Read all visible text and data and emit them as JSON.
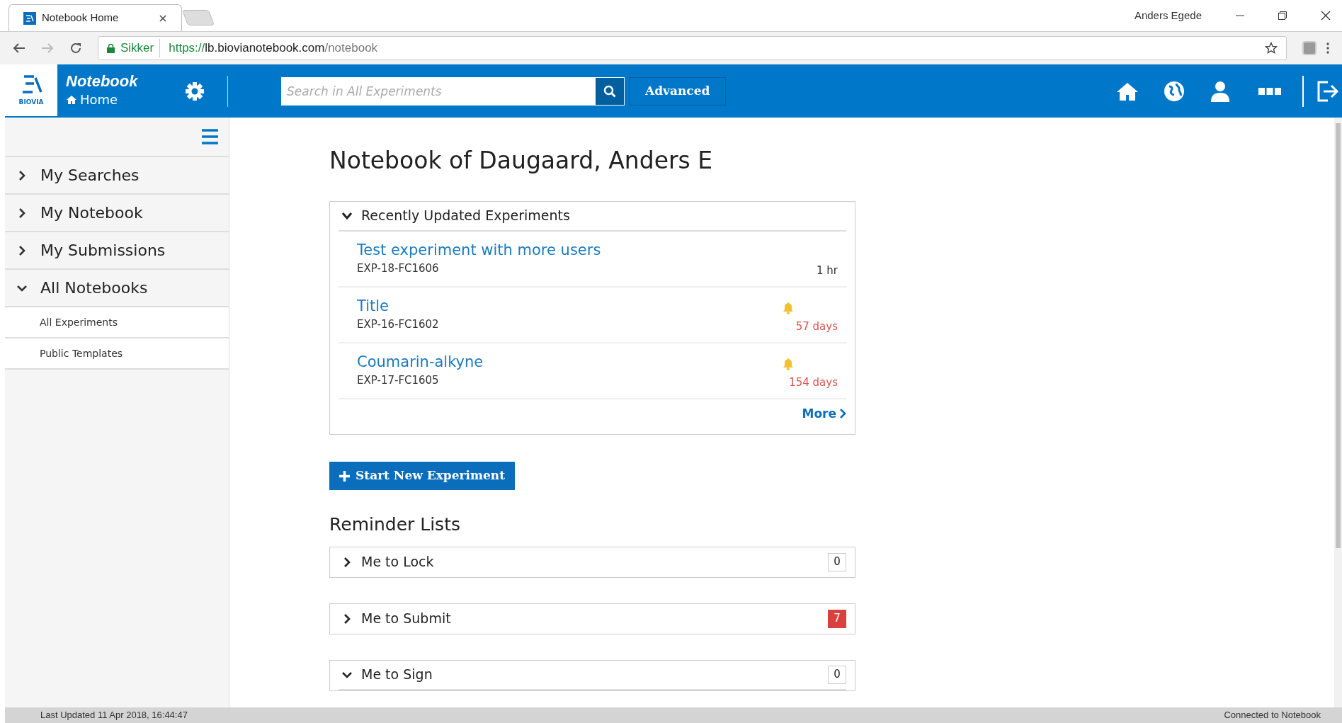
{
  "browser": {
    "tab_title": "Notebook Home",
    "user": "Anders Egede",
    "security_label": "Sikker",
    "url_scheme": "https://",
    "url_host": "lb.biovianotebook.com",
    "url_path": "/notebook"
  },
  "header": {
    "app_name": "Notebook",
    "logo_caption": "BIOVIA",
    "page": "Home",
    "search": {
      "placeholder": "Search in All Experiments"
    },
    "advanced_button": "Advanced"
  },
  "sidebar": {
    "items": [
      {
        "label": "My Searches",
        "expanded": false
      },
      {
        "label": "My Notebook",
        "expanded": false
      },
      {
        "label": "My Submissions",
        "expanded": false
      },
      {
        "label": "All Notebooks",
        "expanded": true,
        "children": [
          {
            "label": "All Experiments"
          },
          {
            "label": "Public Templates"
          }
        ]
      }
    ]
  },
  "main": {
    "title": "Notebook of Daugaard, Anders E",
    "recent": {
      "heading": "Recently Updated Experiments",
      "expanded": true,
      "more_link": "More",
      "experiments": [
        {
          "title": "Test experiment with more users",
          "id": "EXP-18-FC1606",
          "age": "1 hr",
          "overdue": false
        },
        {
          "title": "Title",
          "id": "EXP-16-FC1602",
          "age": "57 days",
          "overdue": true
        },
        {
          "title": "Coumarin-alkyne",
          "id": "EXP-17-FC1605",
          "age": "154 days",
          "overdue": true
        }
      ]
    },
    "new_experiment_button": "Start New Experiment",
    "reminders_heading": "Reminder Lists",
    "reminders": [
      {
        "label": "Me to Lock",
        "count": "0",
        "alert": false,
        "expanded": false
      },
      {
        "label": "Me to Submit",
        "count": "7",
        "alert": true,
        "expanded": false
      },
      {
        "label": "Me to Sign",
        "count": "0",
        "alert": false,
        "expanded": true
      }
    ]
  },
  "status_bar": {
    "left": "Last Updated 11 Apr 2018, 16:44:47",
    "right": "Connected to Notebook"
  }
}
